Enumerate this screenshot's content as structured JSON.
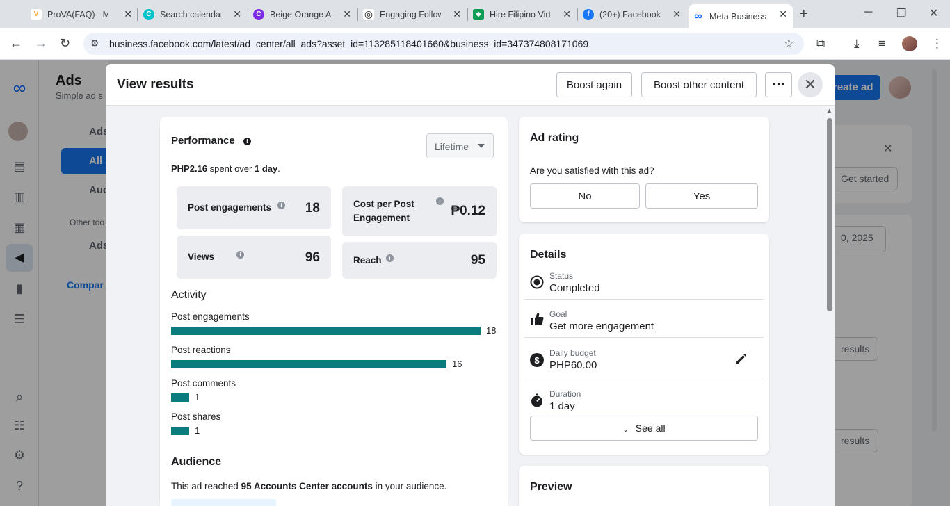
{
  "browser": {
    "tabs": [
      {
        "title": "ProVA(FAQ) - Me",
        "icon": "prova-icon",
        "color": "#f9a825",
        "glyph": "V"
      },
      {
        "title": "Search calendar",
        "icon": "canva-icon",
        "color": "#00c4cc",
        "glyph": "C"
      },
      {
        "title": "Beige Orange Ae",
        "icon": "canva-icon",
        "color": "#7d2ae8",
        "glyph": "C"
      },
      {
        "title": "Engaging Follow",
        "icon": "chatgpt-icon",
        "color": "#202124",
        "glyph": "◎"
      },
      {
        "title": "Hire Filipino Virt",
        "icon": "onlinejobs-icon",
        "color": "#0f9d58",
        "glyph": "◆"
      },
      {
        "title": "(20+) Facebook",
        "icon": "facebook-icon",
        "color": "#1877f2",
        "glyph": "f"
      },
      {
        "title": "Meta Business S",
        "icon": "meta-icon",
        "color": "#0866ff",
        "glyph": "∞"
      }
    ],
    "url": "business.facebook.com/latest/ad_center/all_ads?asset_id=113285118401660&business_id=347374808171069"
  },
  "background": {
    "sidebar_title": "Ads",
    "sidebar_subtitle": "Simple ad s",
    "items": [
      "Ads",
      "All a",
      "Audi"
    ],
    "other_tools": "Other too",
    "ads_item": "Ads",
    "compare_link": "Compar",
    "create_ad": "reate ad",
    "get_started": "Get started",
    "date": "0, 2025",
    "results1": "results",
    "results2": "results"
  },
  "modal": {
    "title": "View results",
    "boost_again": "Boost again",
    "boost_other": "Boost other content",
    "more": "⋯",
    "close": "✕"
  },
  "performance": {
    "title": "Performance",
    "period": "Lifetime",
    "spent_amount": "PHP2.16",
    "spent_mid": " spent over ",
    "spent_duration": "1 day",
    "spent_end": ".",
    "metrics": {
      "post_engagements": {
        "label": "Post engagements",
        "value": "18"
      },
      "cost_per": {
        "label": "Cost per Post Engagement",
        "value": "₱0.12"
      },
      "views": {
        "label": "Views",
        "value": "96"
      },
      "reach": {
        "label": "Reach",
        "value": "95"
      }
    }
  },
  "activity": {
    "title": "Activity",
    "max": 18,
    "items": [
      {
        "label": "Post engagements",
        "value": 18
      },
      {
        "label": "Post reactions",
        "value": 16
      },
      {
        "label": "Post comments",
        "value": 1
      },
      {
        "label": "Post shares",
        "value": 1
      }
    ],
    "bar_color": "#0b7c7e"
  },
  "audience": {
    "title": "Audience",
    "text_pre": "This ad reached ",
    "text_bold": "95 Accounts Center accounts",
    "text_post": " in your audience."
  },
  "rating": {
    "title": "Ad rating",
    "question": "Are you satisfied with this ad?",
    "no": "No",
    "yes": "Yes"
  },
  "details": {
    "title": "Details",
    "status_label": "Status",
    "status_value": "Completed",
    "goal_label": "Goal",
    "goal_value": "Get more engagement",
    "budget_label": "Daily budget",
    "budget_value": "PHP60.00",
    "duration_label": "Duration",
    "duration_value": "1 day",
    "see_all": "See all"
  },
  "preview": {
    "title": "Preview"
  }
}
